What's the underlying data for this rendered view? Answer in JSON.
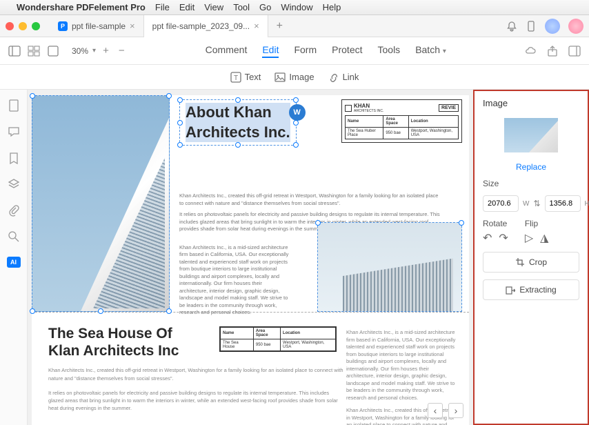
{
  "menubar": {
    "appname": "Wondershare PDFelement Pro",
    "items": [
      "File",
      "Edit",
      "View",
      "Tool",
      "Go",
      "Window",
      "Help"
    ]
  },
  "tabs": {
    "items": [
      {
        "label": "ppt file-sample"
      },
      {
        "label": "ppt file-sample_2023_09..."
      }
    ]
  },
  "toolbar": {
    "zoom": "30%",
    "center_items": [
      "Comment",
      "Edit",
      "Form",
      "Protect",
      "Tools",
      "Batch"
    ],
    "active_index": 1
  },
  "subtoolbar": {
    "items": [
      "Text",
      "Image",
      "Link"
    ]
  },
  "doc": {
    "page1": {
      "heading_l1": "About Khan",
      "heading_l2": "Architects Inc.",
      "logo_name": "KHAN",
      "logo_sub": "ARCHITECTS INC.",
      "reviewed": "REVIE",
      "table": {
        "headers": [
          "Name",
          "Area Space",
          "Location"
        ],
        "row": [
          "The Sea Huber Place",
          "950 bae",
          "Westport, Washington, USA"
        ]
      },
      "p1": "Khan Architects Inc., created this off-grid retreat in Westport, Washington for a family looking for an isolated place to connect with nature and \"distance themselves from social stresses\".",
      "p2": "It relies on photovoltaic panels for electricity and passive building designs to regulate its internal temperature. This includes glazed areas that bring sunlight in to warm the interiors in winter, while an extended west-facing roof provides shade from solar heat during evenings in the summer.",
      "p3": "Khan Architects Inc., is a mid-sized architecture firm based in California, USA. Our exceptionally talented and experienced staff work on projects from boutique interiors to large institutional buildings and airport complexes, locally and internationally. Our firm houses their architecture, interior design, graphic design, landscape and model making staff. We strive to be leaders in the community through work, research and personal choices."
    },
    "page2": {
      "heading_l1": "The Sea House Of",
      "heading_l2": "Klan Architects Inc",
      "table": {
        "headers": [
          "Name",
          "Area Space",
          "Location"
        ],
        "row": [
          "The Sea House",
          "950 bae",
          "Westport, Washington, USA"
        ]
      },
      "p1": "Khan Architects Inc., created this off-grid retreat in Westport, Washington for a family looking for an isolated place to connect with nature and \"distance themselves from social stresses\".",
      "p2": "It relies on photovoltaic panels for electricity and passive building designs to regulate its internal temperature. This includes glazed areas that bring sunlight in to warm the interiors in winter, while an extended west-facing roof provides shade from solar heat during evenings in the summer.",
      "right1": "Khan Architects Inc., is a mid-sized architecture firm based in California, USA. Our exceptionally talented and experienced staff work on projects from boutique interiors to large institutional buildings and airport complexes, locally and internationally. Our firm houses their architecture, interior design, graphic design, landscape and model making staff. We strive to be leaders in the community through work, research and personal choices.",
      "right2": "Khan Architects Inc., created this off-grid retreat in Westport, Washington for a family looking for an isolated place to connect with nature and"
    }
  },
  "rightpanel": {
    "title": "Image",
    "replace": "Replace",
    "size_label": "Size",
    "width": "2070.6",
    "width_unit": "W",
    "height": "1356.8",
    "height_unit": "H",
    "rotate_label": "Rotate",
    "flip_label": "Flip",
    "crop": "Crop",
    "extracting": "Extracting"
  }
}
